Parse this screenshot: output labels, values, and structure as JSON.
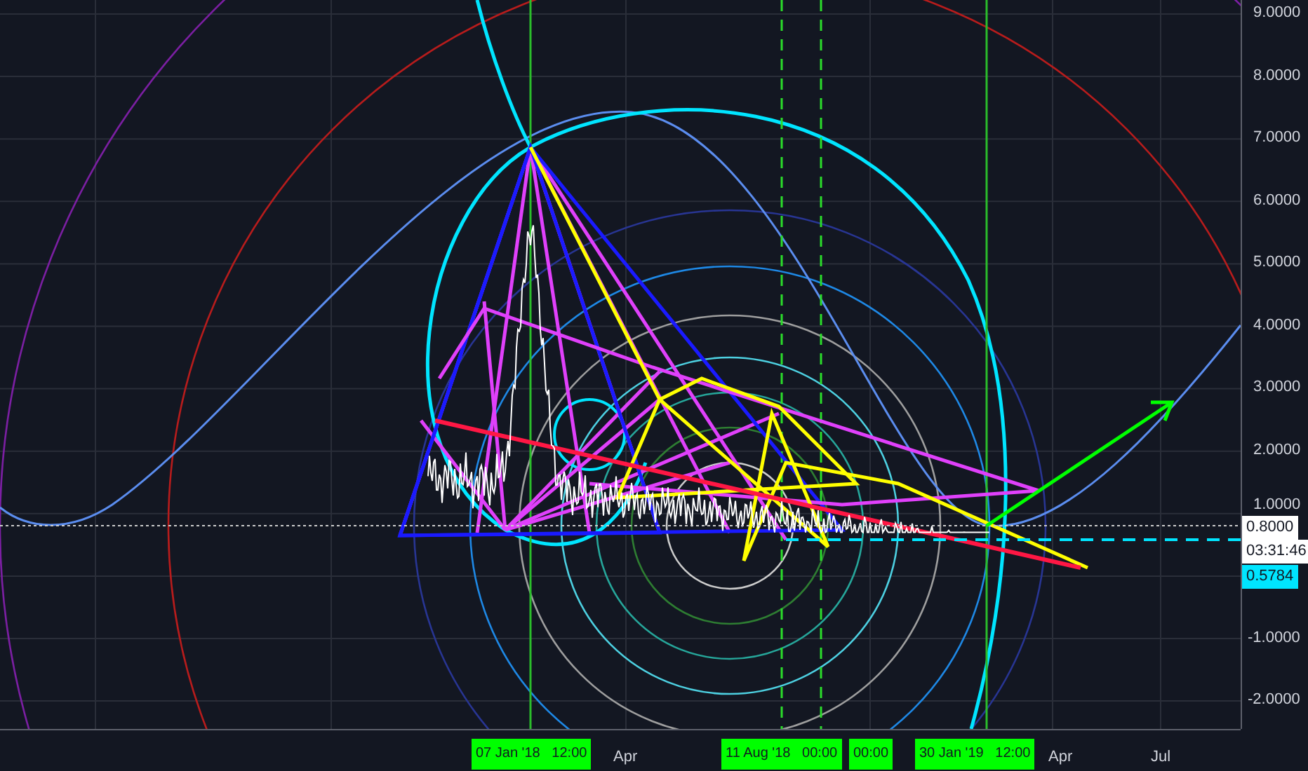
{
  "price_axis": {
    "ticks": [
      "9.0000",
      "8.0000",
      "7.0000",
      "6.0000",
      "5.0000",
      "4.0000",
      "3.0000",
      "2.0000",
      "1.0000",
      "-1.0000",
      "-2.0000"
    ]
  },
  "time_axis": {
    "ticks": [
      "Apr",
      "Apr",
      "Jul"
    ]
  },
  "time_markers": [
    "07 Jan '18   12:00",
    "11 Aug '18   00:00",
    "00:00",
    "30 Jan '19   12:00"
  ],
  "price_tags": [
    {
      "text": "0.8000",
      "kind": "line"
    },
    {
      "text": "03:31:46",
      "kind": "countdown"
    },
    {
      "text": "0.5784",
      "kind": "last"
    }
  ]
}
